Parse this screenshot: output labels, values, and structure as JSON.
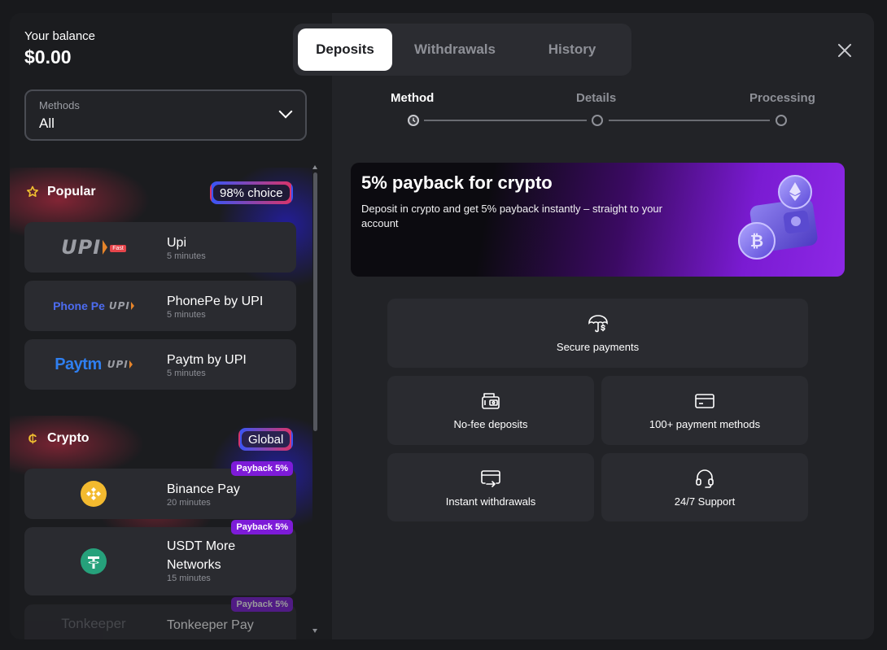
{
  "balance": {
    "label": "Your balance",
    "value": "$0.00"
  },
  "tabs": [
    {
      "label": "Deposits",
      "active": true
    },
    {
      "label": "Withdrawals",
      "active": false
    },
    {
      "label": "History",
      "active": false
    }
  ],
  "methods_filter": {
    "label": "Methods",
    "value": "All"
  },
  "sections": {
    "popular": {
      "title": "Popular",
      "badge": "98% choice",
      "items": [
        {
          "name": "Upi",
          "time": "5 minutes",
          "logo": "upi-logo",
          "logo_text": "UPI",
          "tag": "Fast"
        },
        {
          "name": "PhonePe by UPI",
          "time": "5 minutes",
          "logo": "phonepe-upi-logo",
          "logo_text": "Phone Pe",
          "logo_sub": "UPI"
        },
        {
          "name": "Paytm by UPI",
          "time": "5 minutes",
          "logo": "paytm-upi-logo",
          "logo_text": "Paytm",
          "logo_sub": "UPI"
        }
      ]
    },
    "crypto": {
      "title": "Crypto",
      "badge": "Global",
      "items": [
        {
          "name": "Binance Pay",
          "time": "20 minutes",
          "payback": "Payback 5%",
          "logo": "binance-icon"
        },
        {
          "name": "USDT More Networks",
          "time": "15 minutes",
          "payback": "Payback 5%",
          "logo": "tether-icon"
        },
        {
          "name": "Tonkeeper Pay",
          "time": "",
          "payback": "Payback 5%",
          "logo": "tonkeeper-logo",
          "logo_text": "Tonkeeper"
        }
      ]
    }
  },
  "steps": [
    {
      "label": "Method",
      "active": true
    },
    {
      "label": "Details",
      "active": false
    },
    {
      "label": "Processing",
      "active": false
    }
  ],
  "promo": {
    "title": "5% payback for crypto",
    "text": "Deposit in crypto and get 5% payback instantly – straight to your account"
  },
  "features": [
    {
      "label": "Secure payments",
      "icon": "umbrella-dollar-icon"
    },
    {
      "label": "No-fee deposits",
      "icon": "cash-register-icon"
    },
    {
      "label": "100+ payment methods",
      "icon": "card-icon"
    },
    {
      "label": "Instant withdrawals",
      "icon": "withdraw-icon"
    },
    {
      "label": "24/7 Support",
      "icon": "headset-icon"
    }
  ],
  "colors": {
    "modal_bg": "#222327",
    "sidebar_bg": "#1b1c1f",
    "card_bg": "#2a2b30",
    "payback_badge": "#7d1bd8",
    "accent_star": "#f2c230"
  }
}
